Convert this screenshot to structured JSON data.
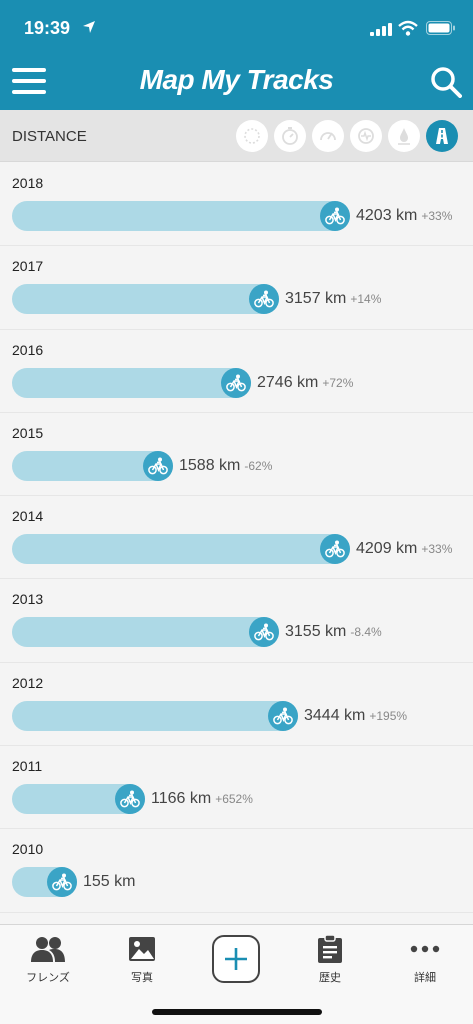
{
  "status": {
    "time": "19:39"
  },
  "header": {
    "title": "Map My Tracks"
  },
  "filter": {
    "label": "DISTANCE",
    "icons": [
      "calendar-icon",
      "stopwatch-icon",
      "speed-icon",
      "heart-rate-icon",
      "elevation-icon",
      "distance-icon"
    ],
    "active_index": 5
  },
  "rows": [
    {
      "year": "2018",
      "distance": "4203 km",
      "change": "+33%",
      "ratio": 1.0
    },
    {
      "year": "2017",
      "distance": "3157 km",
      "change": "+14%",
      "ratio": 0.751
    },
    {
      "year": "2016",
      "distance": "2746 km",
      "change": "+72%",
      "ratio": 0.653
    },
    {
      "year": "2015",
      "distance": "1588 km",
      "change": "-62%",
      "ratio": 0.378
    },
    {
      "year": "2014",
      "distance": "4209 km",
      "change": "+33%",
      "ratio": 1.0
    },
    {
      "year": "2013",
      "distance": "3155 km",
      "change": "-8.4%",
      "ratio": 0.75
    },
    {
      "year": "2012",
      "distance": "3444 km",
      "change": "+195%",
      "ratio": 0.818
    },
    {
      "year": "2011",
      "distance": "1166 km",
      "change": "+652%",
      "ratio": 0.277
    },
    {
      "year": "2010",
      "distance": "155 km",
      "change": "",
      "ratio": 0.037
    }
  ],
  "tabs": [
    {
      "label": "フレンズ",
      "icon": "friends-icon"
    },
    {
      "label": "写真",
      "icon": "photos-icon"
    },
    {
      "label": "",
      "icon": "add-icon"
    },
    {
      "label": "歴史",
      "icon": "history-icon"
    },
    {
      "label": "詳細",
      "icon": "more-icon"
    }
  ],
  "colors": {
    "brand": "#1a8eb2",
    "bar": "#add9e6",
    "bike": "#3aa4c6"
  }
}
